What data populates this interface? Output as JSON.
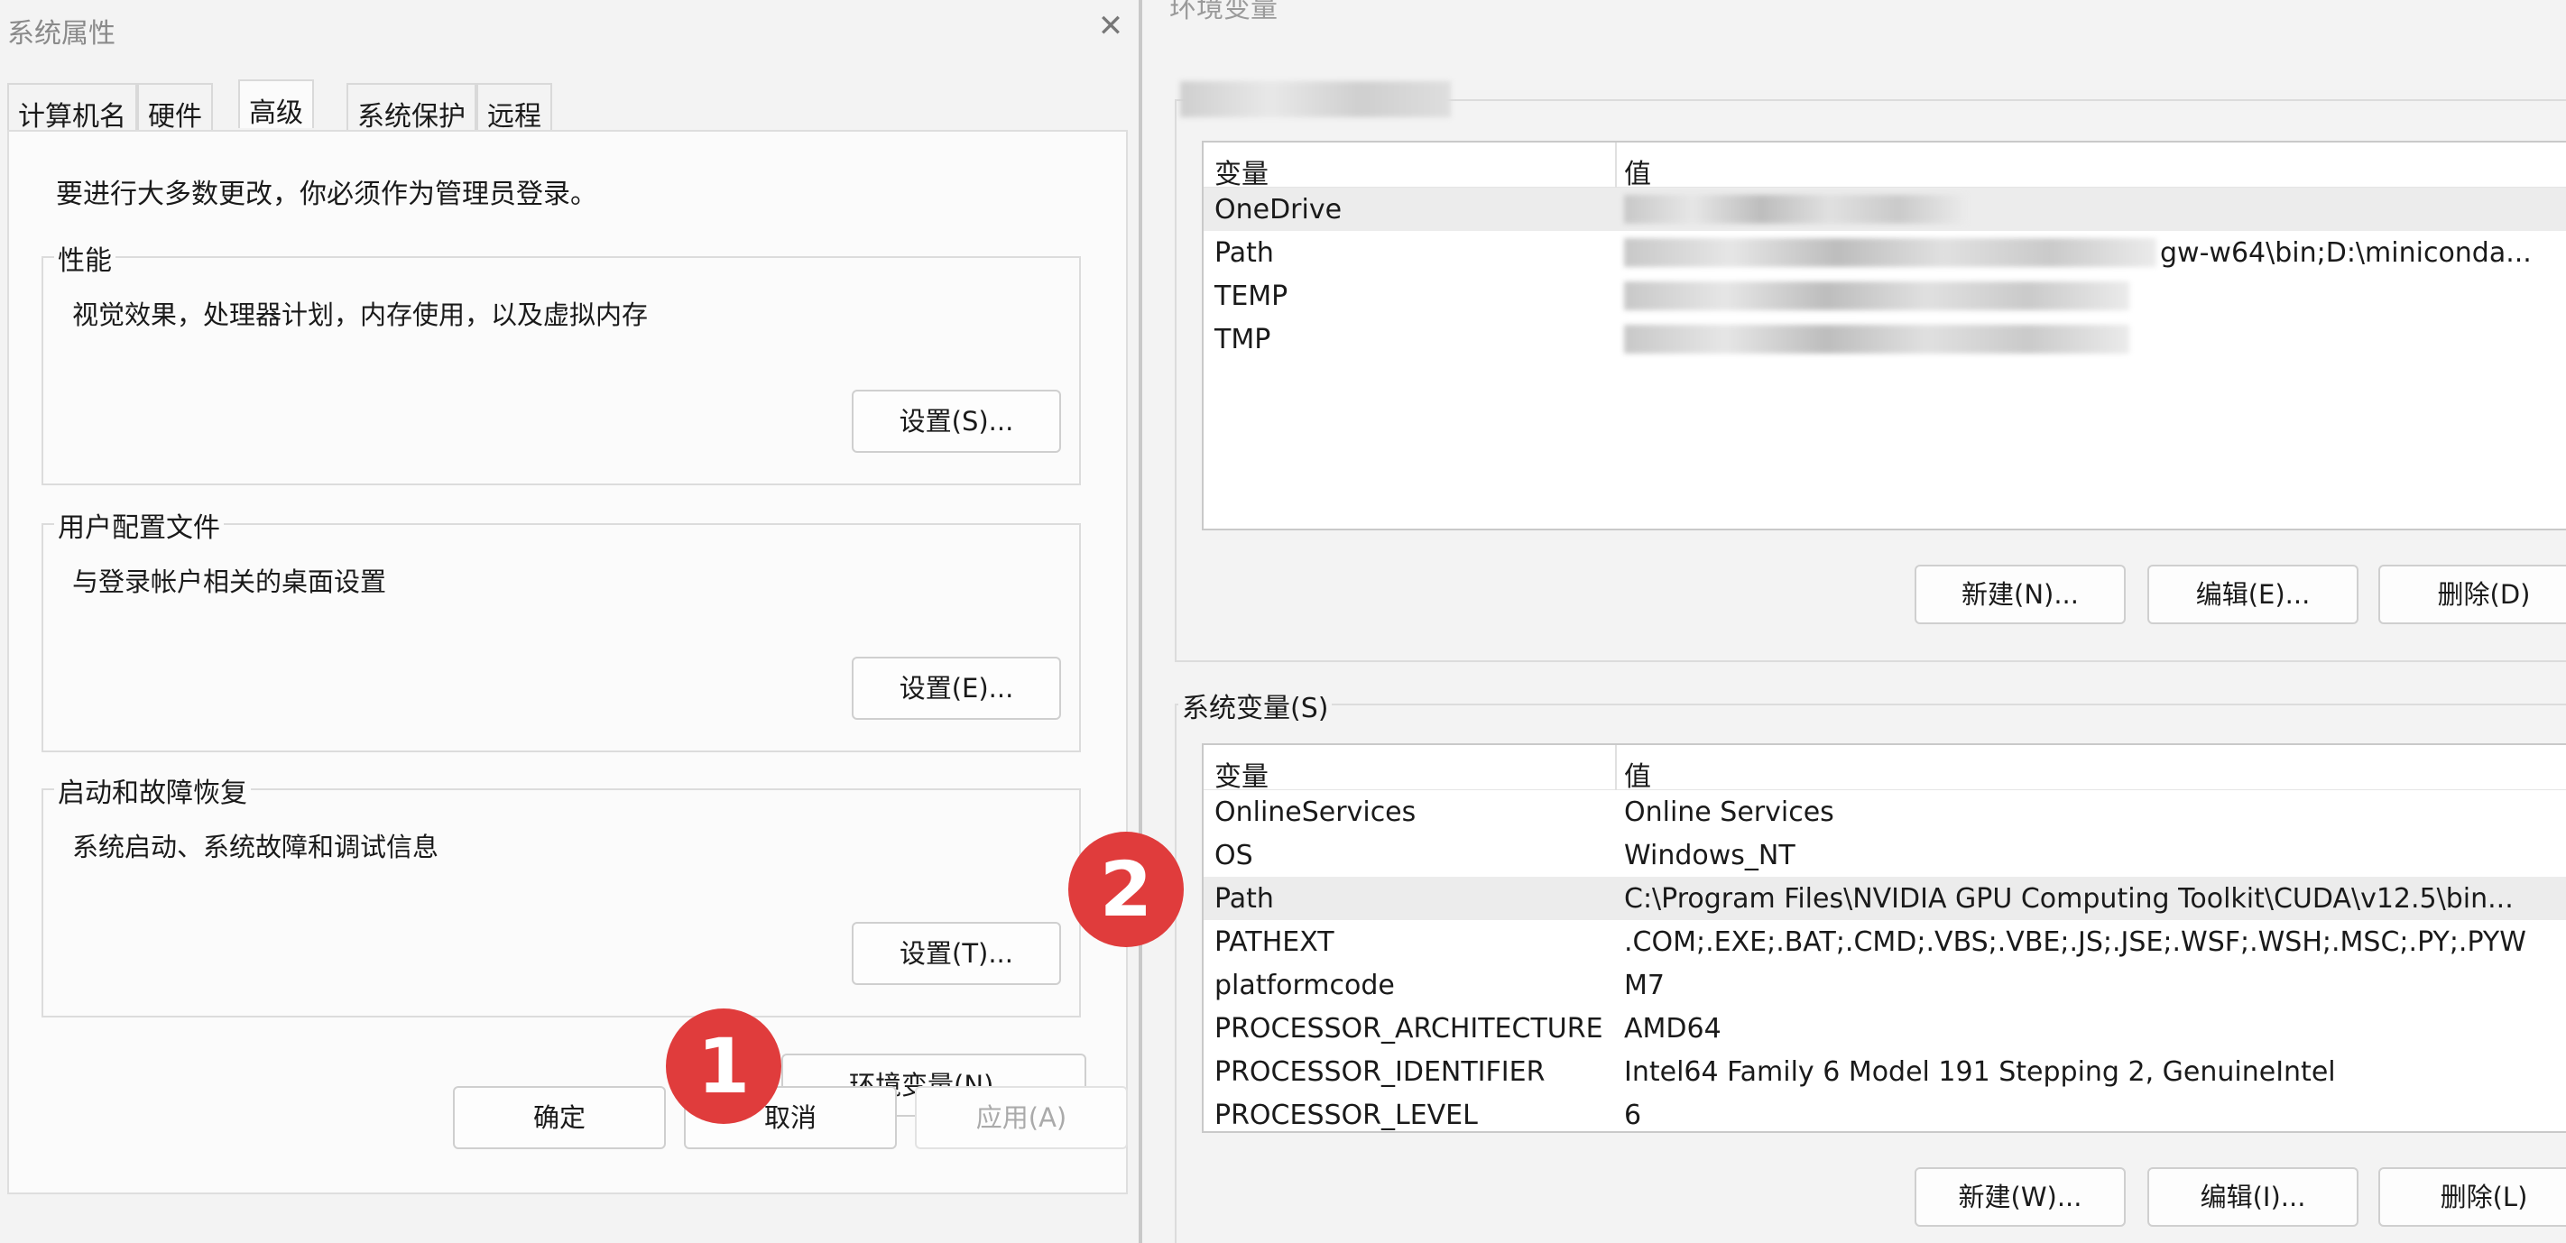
{
  "system_properties": {
    "title": "系统属性",
    "close_glyph": "✕",
    "tabs": [
      {
        "label": "计算机名",
        "active": false
      },
      {
        "label": "硬件",
        "active": false
      },
      {
        "label": "高级",
        "active": true
      },
      {
        "label": "系统保护",
        "active": false
      },
      {
        "label": "远程",
        "active": false
      }
    ],
    "admin_note": "要进行大多数更改，你必须作为管理员登录。",
    "groups": [
      {
        "title": "性能",
        "description": "视觉效果，处理器计划，内存使用，以及虚拟内存",
        "button": "设置(S)..."
      },
      {
        "title": "用户配置文件",
        "description": "与登录帐户相关的桌面设置",
        "button": "设置(E)..."
      },
      {
        "title": "启动和故障恢复",
        "description": "系统启动、系统故障和调试信息",
        "button": "设置(T)..."
      }
    ],
    "env_button": "环境变量(N)...",
    "ok_button": "确定",
    "cancel_button": "取消",
    "apply_button": "应用(A)"
  },
  "environment_variables": {
    "title": "环境变量",
    "user_vars": {
      "headers": {
        "name": "变量",
        "value": "值"
      },
      "rows": [
        {
          "name": "OneDrive",
          "value": "",
          "selected": true
        },
        {
          "name": "Path",
          "value": "gw-w64\\bin;D:\\miniconda...",
          "selected": false
        },
        {
          "name": "TEMP",
          "value": "",
          "selected": false
        },
        {
          "name": "TMP",
          "value": "",
          "selected": false
        }
      ],
      "buttons": {
        "new": "新建(N)...",
        "edit": "编辑(E)...",
        "delete": "删除(D)"
      }
    },
    "system_vars": {
      "label": "系统变量(S)",
      "headers": {
        "name": "变量",
        "value": "值"
      },
      "rows": [
        {
          "name": "OnlineServices",
          "value": "Online Services",
          "selected": false
        },
        {
          "name": "OS",
          "value": "Windows_NT",
          "selected": false
        },
        {
          "name": "Path",
          "value": "C:\\Program Files\\NVIDIA GPU Computing Toolkit\\CUDA\\v12.5\\bin...",
          "selected": true
        },
        {
          "name": "PATHEXT",
          "value": ".COM;.EXE;.BAT;.CMD;.VBS;.VBE;.JS;.JSE;.WSF;.WSH;.MSC;.PY;.PYW",
          "selected": false
        },
        {
          "name": "platformcode",
          "value": "M7",
          "selected": false
        },
        {
          "name": "PROCESSOR_ARCHITECTURE",
          "value": "AMD64",
          "selected": false
        },
        {
          "name": "PROCESSOR_IDENTIFIER",
          "value": "Intel64 Family 6 Model 191 Stepping 2, GenuineIntel",
          "selected": false
        },
        {
          "name": "PROCESSOR_LEVEL",
          "value": "6",
          "selected": false
        }
      ],
      "buttons": {
        "new": "新建(W)...",
        "edit": "编辑(I)...",
        "delete": "删除(L)"
      }
    }
  },
  "annotations": {
    "step1": "1",
    "step2": "2",
    "color": "#e03c3c"
  }
}
